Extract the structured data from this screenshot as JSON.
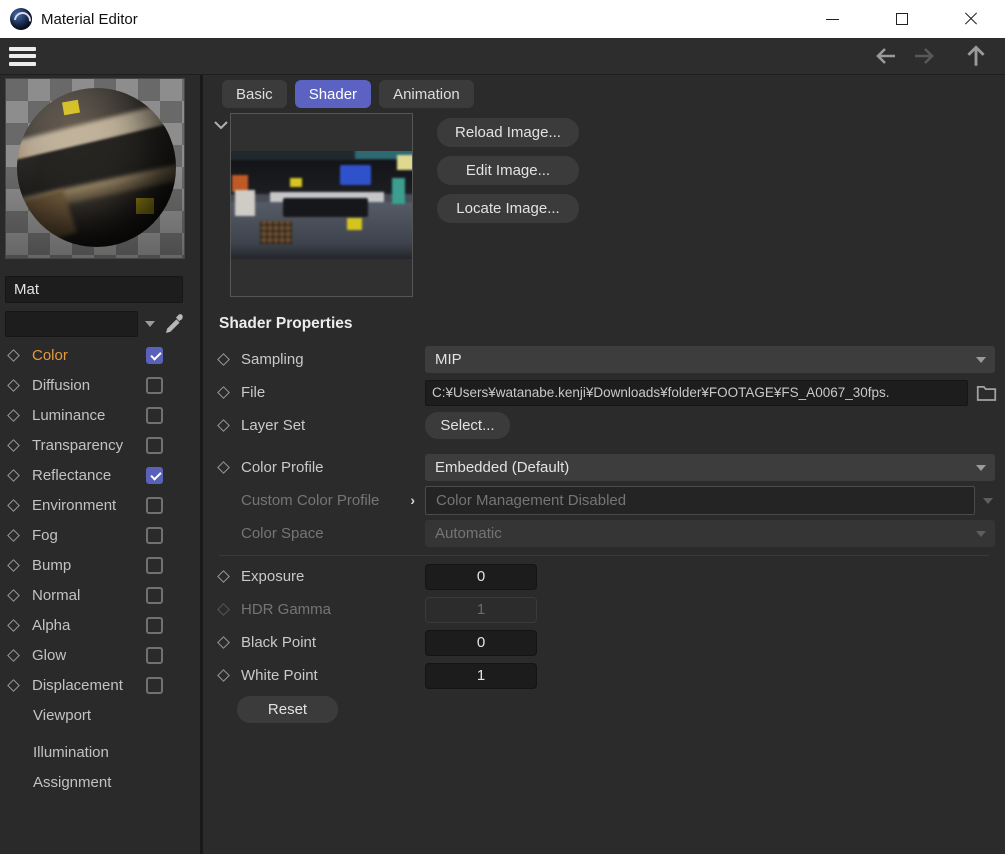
{
  "window": {
    "title": "Material Editor"
  },
  "icons": {
    "app": "cinema4d-logo",
    "menu": "hamburger",
    "back": "arrow-left",
    "forward": "arrow-right",
    "up": "arrow-up",
    "minimize": "minimize",
    "maximize": "maximize",
    "close": "close",
    "channel": "diamond",
    "picker": "eyedropper",
    "file_browse": "folder",
    "expand": "chevron-right",
    "collapse": "chevron-down"
  },
  "material": {
    "name": "Mat",
    "search_value": ""
  },
  "channels": [
    {
      "label": "Color",
      "checked": true
    },
    {
      "label": "Diffusion",
      "checked": false
    },
    {
      "label": "Luminance",
      "checked": false
    },
    {
      "label": "Transparency",
      "checked": false
    },
    {
      "label": "Reflectance",
      "checked": true
    },
    {
      "label": "Environment",
      "checked": false
    },
    {
      "label": "Fog",
      "checked": false
    },
    {
      "label": "Bump",
      "checked": false
    },
    {
      "label": "Normal",
      "checked": false
    },
    {
      "label": "Alpha",
      "checked": false
    },
    {
      "label": "Glow",
      "checked": false
    },
    {
      "label": "Displacement",
      "checked": false
    }
  ],
  "sections": {
    "viewport": "Viewport",
    "illumination": "Illumination",
    "assignment": "Assignment"
  },
  "tabs": {
    "basic": "Basic",
    "shader": "Shader",
    "animation": "Animation"
  },
  "image_actions": {
    "reload": "Reload Image...",
    "edit": "Edit Image...",
    "locate": "Locate Image..."
  },
  "shader": {
    "heading": "Shader Properties",
    "sampling_label": "Sampling",
    "sampling_value": "MIP",
    "file_label": "File",
    "file_value": "C:¥Users¥watanabe.kenji¥Downloads¥folder¥FOOTAGE¥FS_A0067_30fps.",
    "layer_set_label": "Layer Set",
    "layer_set_button": "Select...",
    "color_profile_label": "Color Profile",
    "color_profile_value": "Embedded (Default)",
    "custom_profile_label": "Custom Color Profile",
    "custom_profile_value": "Color Management Disabled",
    "color_space_label": "Color Space",
    "color_space_value": "Automatic",
    "exposure_label": "Exposure",
    "exposure_value": "0",
    "hdr_gamma_label": "HDR Gamma",
    "hdr_gamma_value": "1",
    "black_point_label": "Black Point",
    "black_point_value": "0",
    "white_point_label": "White Point",
    "white_point_value": "1",
    "reset_button": "Reset"
  },
  "colors": {
    "accent": "#5c62c1",
    "checkbox_checked": "#5a61ba",
    "active_channel_text": "#e59a3c",
    "titlebar_bg": "#ffffff",
    "panel_bg": "#2a2a2b"
  }
}
